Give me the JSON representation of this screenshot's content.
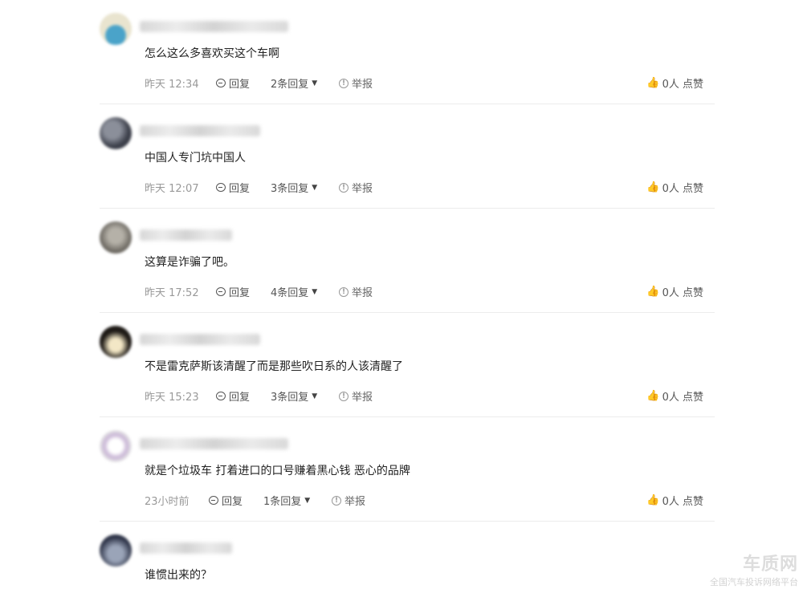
{
  "comments": [
    {
      "text": "怎么这么多喜欢买这个车啊",
      "time": "昨天 12:34",
      "reply_label": "回复",
      "replies_label": "2条回复",
      "report_label": "举报",
      "like_label": "0人 点赞"
    },
    {
      "text": "中国人专门坑中国人",
      "time": "昨天 12:07",
      "reply_label": "回复",
      "replies_label": "3条回复",
      "report_label": "举报",
      "like_label": "0人 点赞"
    },
    {
      "text": "这算是诈骗了吧。",
      "time": "昨天 17:52",
      "reply_label": "回复",
      "replies_label": "4条回复",
      "report_label": "举报",
      "like_label": "0人 点赞"
    },
    {
      "text": "不是雷克萨斯该清醒了而是那些吹日系的人该清醒了",
      "time": "昨天 15:23",
      "reply_label": "回复",
      "replies_label": "3条回复",
      "report_label": "举报",
      "like_label": "0人 点赞"
    },
    {
      "text": "就是个垃圾车 打着进口的口号赚着黑心钱 恶心的品牌",
      "time": "23小时前",
      "reply_label": "回复",
      "replies_label": "1条回复",
      "report_label": "举报",
      "like_label": "0人 点赞"
    },
    {
      "text": "谁惯出来的？"
    }
  ],
  "icons": {
    "reply": "speech-bubble-icon",
    "dropdown": "caret-down-icon",
    "report": "info-circle-icon",
    "like": "thumbs-up-icon"
  },
  "watermark": {
    "logo": "车质网",
    "sub": "全国汽车投诉网络平台"
  }
}
